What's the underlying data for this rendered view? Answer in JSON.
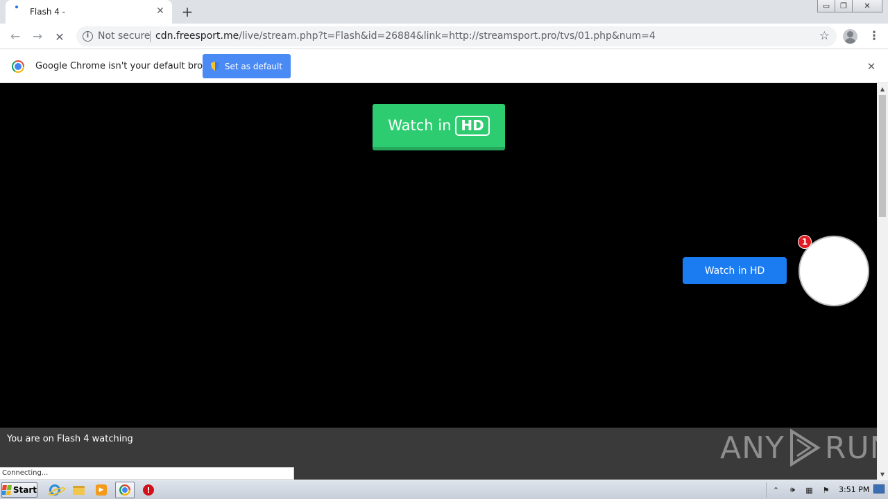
{
  "browser": {
    "tab": {
      "title": "Flash 4 -"
    },
    "window_controls": {
      "minimize": "▭",
      "restore": "❐",
      "close": "✕"
    },
    "nav": {
      "back": "←",
      "forward": "→",
      "stop": "✕"
    },
    "omnibox": {
      "security_label": "Not secure",
      "url_host": "cdn.freesport.me",
      "url_path": "/live/stream.php?t=Flash&id=26884&link=http://streamsport.pro/tvs/01.php&num=4"
    },
    "infobar": {
      "message": "Google Chrome isn't your default browser",
      "button_label": "Set as default"
    },
    "status": "Connecting..."
  },
  "page": {
    "watch_hd_prefix": "Watch in",
    "watch_hd_badge": "HD",
    "watch_hd_blue": "Watch in HD",
    "notification_count": "1",
    "footer_text": "You are on Flash 4 watching",
    "watermark_left": "ANY",
    "watermark_right": "RUN"
  },
  "taskbar": {
    "start_label": "Start",
    "clock": "3:51 PM",
    "items": [
      "internet-explorer",
      "explorer",
      "media-player",
      "chrome",
      "stop"
    ]
  },
  "icons": [
    "info-icon",
    "star-icon",
    "profile-icon",
    "menu-icon",
    "chrome-logo-icon",
    "shield-icon",
    "close-icon"
  ],
  "colors": {
    "green_button": "#2ecc71",
    "blue_button": "#1a7cf0",
    "set_default_button": "#4a8af4",
    "badge": "#e01b22"
  }
}
